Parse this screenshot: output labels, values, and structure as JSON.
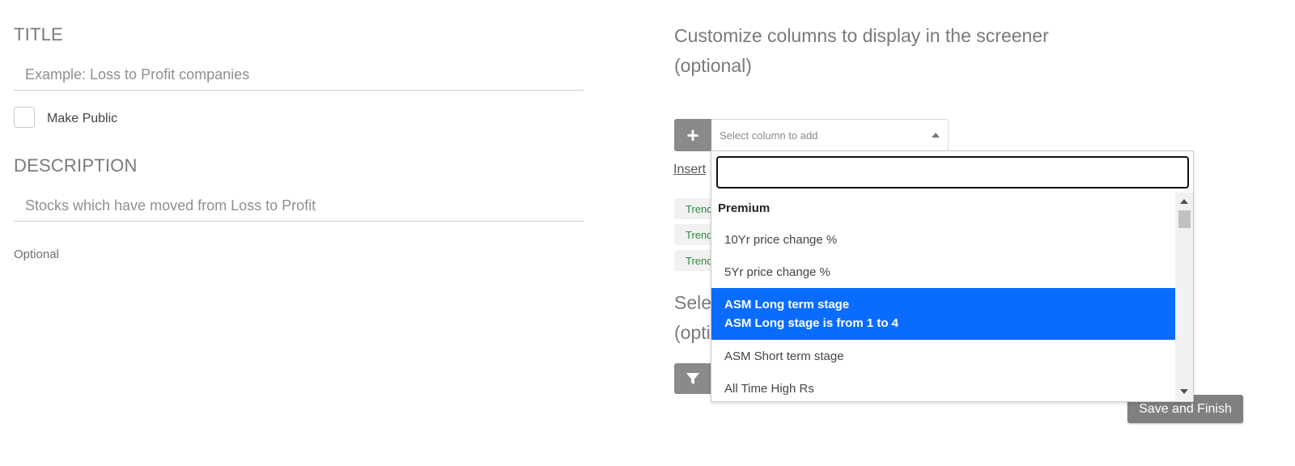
{
  "left": {
    "title_label": "TITLE",
    "title_placeholder": "Example: Loss to Profit companies",
    "make_public_label": "Make Public",
    "description_label": "DESCRIPTION",
    "description_placeholder": "Stocks which have moved from Loss to Profit",
    "optional_hint": "Optional"
  },
  "right": {
    "heading_line1": "Customize columns to display in the screener",
    "heading_line2": "(optional)",
    "add_icon": "plus-icon",
    "select_placeholder": "Select column to add",
    "insert_link": "Insert",
    "chips": [
      "Trend",
      "Trend",
      "Trend"
    ],
    "partial_heading_line1": "Sele",
    "partial_heading_line2": "(opti",
    "filter_icon": "filter-icon",
    "save_button": "Save and Finish"
  },
  "dropdown": {
    "search_value": "",
    "group_label": "Premium",
    "options": [
      {
        "label": "10Yr price change %"
      },
      {
        "label": "5Yr price change %"
      },
      {
        "label": "ASM Long term stage",
        "sublabel": "ASM Long stage is from 1 to 4",
        "highlighted": true
      },
      {
        "label": "ASM Short term stage"
      },
      {
        "label": "All Time High Rs"
      }
    ],
    "highlight_color": "#0a6cff"
  }
}
